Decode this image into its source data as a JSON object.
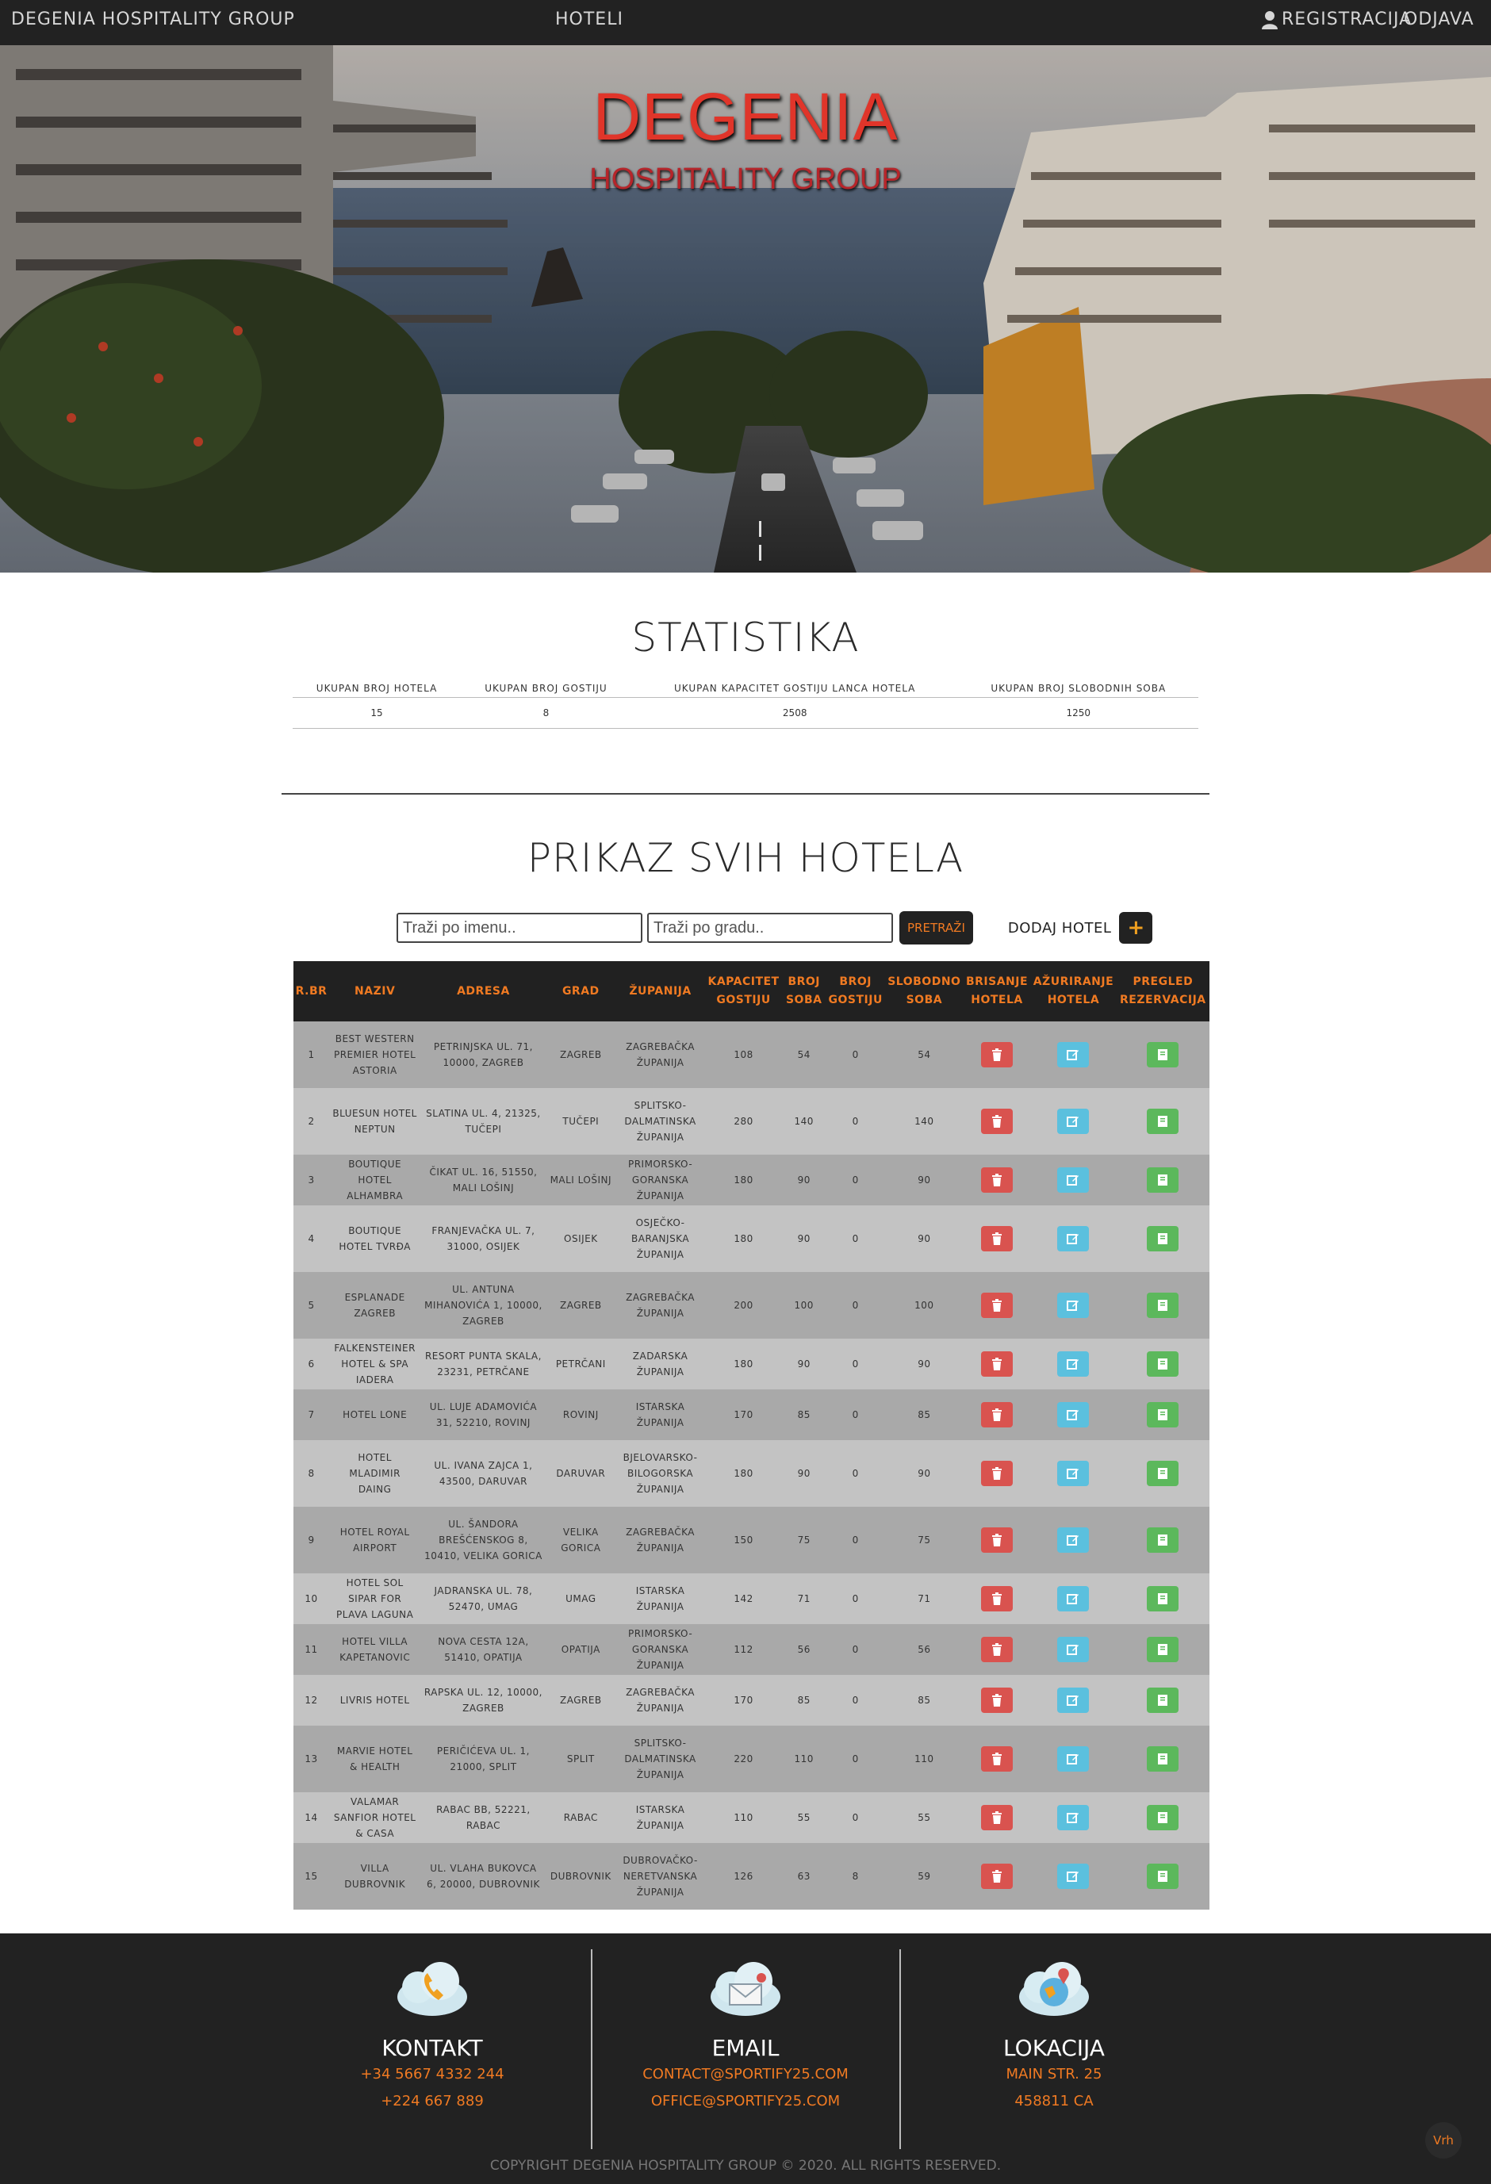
{
  "navbar": {
    "brand": "Degenia Hospitality Group",
    "hotels_link": "Hoteli",
    "register_link": "Registracija",
    "logout_link": "Odjava"
  },
  "hero": {
    "title": "DEGENIA",
    "subtitle": "HOSPITALITY GROUP"
  },
  "stats": {
    "title": "Statistika",
    "headers": [
      "Ukupan broj hotela",
      "Ukupan broj gostiju",
      "Ukupan kapacitet gostiju lanca hotela",
      "Ukupan broj slobodnih soba"
    ],
    "values": [
      "15",
      "8",
      "2508",
      "1250"
    ]
  },
  "hotels_section": {
    "title": "Prikaz svih hotela",
    "search_name_placeholder": "Traži po imenu..",
    "search_city_placeholder": "Traži po gradu..",
    "search_button": "Pretraži",
    "add_label": "Dodaj hotel",
    "add_button": "+"
  },
  "table": {
    "headers": [
      "R.Br",
      "Naziv",
      "Adresa",
      "Grad",
      "Županija",
      "Kapacitet gostiju",
      "Broj soba",
      "Broj gostiju",
      "Slobodno soba",
      "Brisanje hotela",
      "Ažuriranje hotela",
      "Pregled rezervacija"
    ],
    "rows": [
      [
        "1",
        "Best Western Premier Hotel Astoria",
        "Petrinjska ul. 71, 10000, Zagreb",
        "Zagreb",
        "Zagrebačka županija",
        "108",
        "54",
        "0",
        "54"
      ],
      [
        "2",
        "Bluesun Hotel Neptun",
        "Slatina ul. 4, 21325, Tučepi",
        "Tučepi",
        "Splitsko-dalmatinska županija",
        "280",
        "140",
        "0",
        "140"
      ],
      [
        "3",
        "Boutique Hotel Alhambra",
        "Čikat ul. 16, 51550, Mali Lošinj",
        "Mali Lošinj",
        "Primorsko-goranska županija",
        "180",
        "90",
        "0",
        "90"
      ],
      [
        "4",
        "Boutique Hotel Tvrđa",
        "Franjevačka ul. 7, 31000, Osijek",
        "Osijek",
        "Osječko-baranjska županija",
        "180",
        "90",
        "0",
        "90"
      ],
      [
        "5",
        "Esplanade Zagreb",
        "Ul. Antuna Mihanovića 1, 10000, Zagreb",
        "Zagreb",
        "Zagrebačka županija",
        "200",
        "100",
        "0",
        "100"
      ],
      [
        "6",
        "Falkensteiner Hotel & Spa Iadera",
        "Resort Punta Skala, 23231, Petrčane",
        "Petrčani",
        "Zadarska županija",
        "180",
        "90",
        "0",
        "90"
      ],
      [
        "7",
        "Hotel Lone",
        "Ul. Luje Adamovića 31, 52210, Rovinj",
        "Rovinj",
        "Istarska županija",
        "170",
        "85",
        "0",
        "85"
      ],
      [
        "8",
        "Hotel Mladimir Daing",
        "Ul. Ivana Zajca 1, 43500, Daruvar",
        "Daruvar",
        "Bjelovarsko-bilogorska županija",
        "180",
        "90",
        "0",
        "90"
      ],
      [
        "9",
        "Hotel Royal Airport",
        "Ul. Šandora Brešćenskog 8, 10410, Velika Gorica",
        "Velika Gorica",
        "Zagrebačka županija",
        "150",
        "75",
        "0",
        "75"
      ],
      [
        "10",
        "Hotel Sol Sipar for Plava Laguna",
        "Jadranska ul. 78, 52470, Umag",
        "Umag",
        "Istarska županija",
        "142",
        "71",
        "0",
        "71"
      ],
      [
        "11",
        "Hotel Villa Kapetanovic",
        "Nova cesta 12A, 51410, Opatija",
        "Opatija",
        "Primorsko-goranska županija",
        "112",
        "56",
        "0",
        "56"
      ],
      [
        "12",
        "Livris Hotel",
        "Rapska ul. 12, 10000, Zagreb",
        "Zagreb",
        "Zagrebačka županija",
        "170",
        "85",
        "0",
        "85"
      ],
      [
        "13",
        "Marvie Hotel & Health",
        "Peričićeva ul. 1, 21000, Split",
        "Split",
        "Splitsko-dalmatinska županija",
        "220",
        "110",
        "0",
        "110"
      ],
      [
        "14",
        "Valamar Sanfior Hotel & Casa",
        "Rabac bb, 52221, Rabac",
        "Rabac",
        "Istarska županija",
        "110",
        "55",
        "0",
        "55"
      ],
      [
        "15",
        "Villa Dubrovnik",
        "Ul. Vlaha Bukovca 6, 20000, Dubrovnik",
        "Dubrovnik",
        "Dubrovačko-neretvanska županija",
        "126",
        "63",
        "8",
        "59"
      ]
    ]
  },
  "footer": {
    "contact": {
      "title": "Kontakt",
      "lines": [
        "+34 5667 4332 244",
        "+224 667 889"
      ]
    },
    "email": {
      "title": "Email",
      "lines": [
        "contact@sportify25.com",
        "office@sportify25.com"
      ]
    },
    "location": {
      "title": "Lokacija",
      "lines": [
        "Main Str. 25",
        "458811 CA"
      ]
    },
    "copyright": "Copyright Degenia Hospitality Group © 2020. All rights reserved.",
    "back_to_top": "Vrh"
  },
  "colors": {
    "accent": "#f07a22",
    "dark": "#222222",
    "hero_title": "#e0352a",
    "delete": "#d9534f",
    "update": "#5bc0de",
    "view": "#5cb85c"
  },
  "icons": {
    "user": "user-icon",
    "delete": "trash-icon",
    "update": "edit-icon",
    "view": "book-icon",
    "contact": "phone-cloud-icon",
    "email": "envelope-cloud-icon",
    "location": "globe-pin-icon"
  }
}
